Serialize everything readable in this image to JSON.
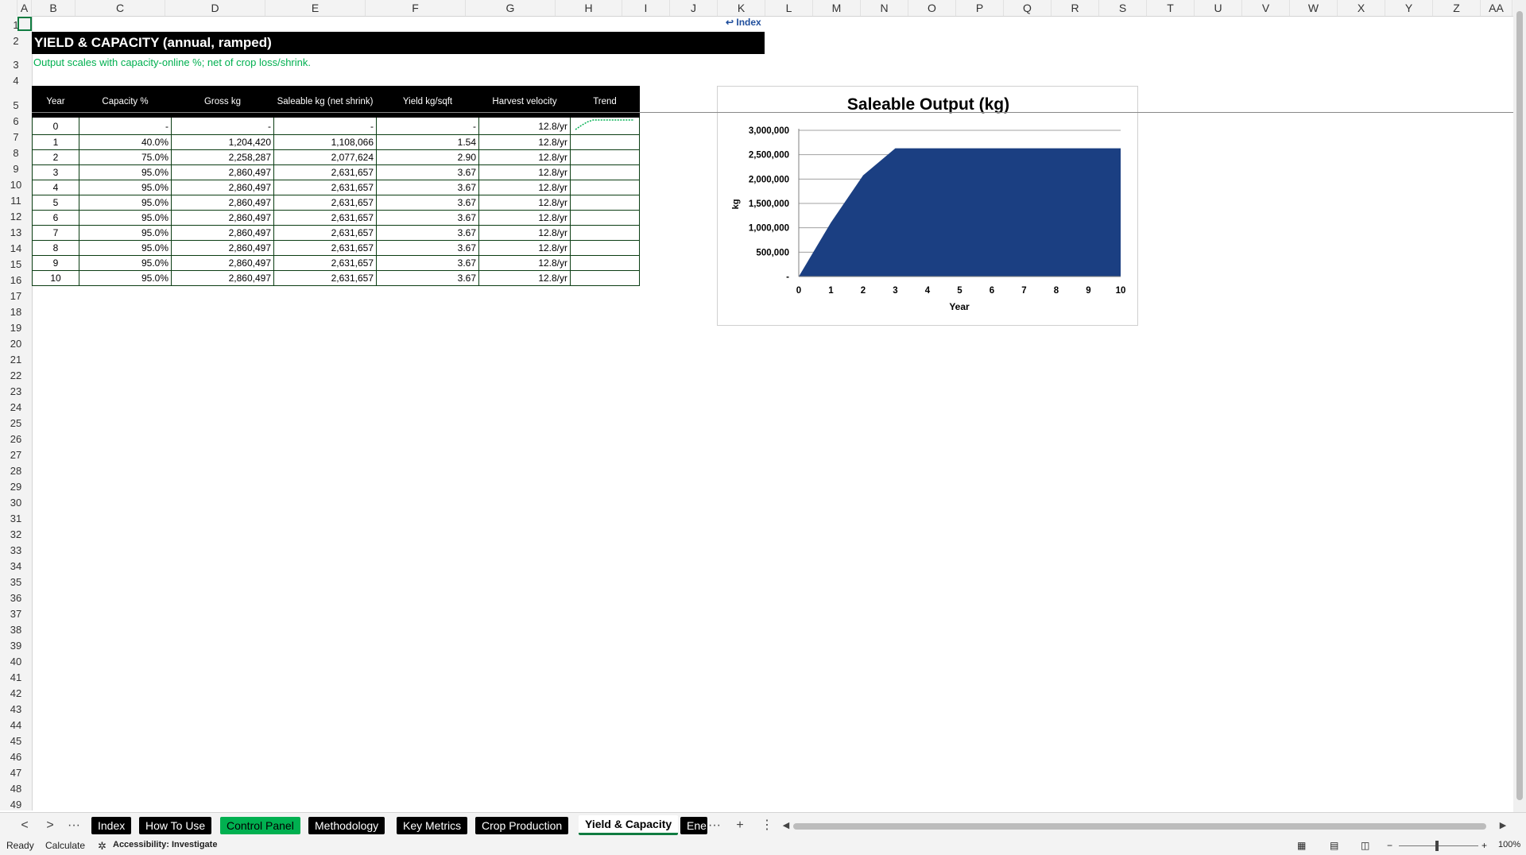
{
  "columns": [
    "A",
    "B",
    "C",
    "D",
    "E",
    "F",
    "G",
    "H",
    "I",
    "J",
    "K",
    "L",
    "M",
    "N",
    "O",
    "P",
    "Q",
    "R",
    "S",
    "T",
    "U",
    "V",
    "W",
    "X",
    "Y",
    "Z",
    "AA"
  ],
  "rows": [
    "1",
    "2",
    "3",
    "4",
    "5",
    "6",
    "7",
    "8",
    "9",
    "10",
    "11",
    "12",
    "13",
    "14",
    "15",
    "16",
    "17",
    "18",
    "19",
    "20",
    "21",
    "22",
    "23",
    "24",
    "25",
    "26",
    "27",
    "28",
    "29",
    "30",
    "31",
    "32",
    "33",
    "34",
    "35",
    "36",
    "37",
    "38",
    "39",
    "40",
    "41",
    "42",
    "43",
    "44",
    "45",
    "46",
    "47",
    "48",
    "49"
  ],
  "sheet": {
    "index_link": "↩ Index",
    "title": "YIELD & CAPACITY (annual, ramped)",
    "subtitle": "Output scales with capacity-online %; net of crop loss/shrink."
  },
  "table": {
    "headers": [
      "Year",
      "Capacity %",
      "Gross kg",
      "Saleable kg (net shrink)",
      "Yield kg/sqft",
      "Harvest velocity",
      "Trend"
    ],
    "rows": [
      [
        "0",
        "-",
        "-",
        "-",
        "-",
        "12.8/yr"
      ],
      [
        "1",
        "40.0%",
        "1,204,420",
        "1,108,066",
        "1.54",
        "12.8/yr"
      ],
      [
        "2",
        "75.0%",
        "2,258,287",
        "2,077,624",
        "2.90",
        "12.8/yr"
      ],
      [
        "3",
        "95.0%",
        "2,860,497",
        "2,631,657",
        "3.67",
        "12.8/yr"
      ],
      [
        "4",
        "95.0%",
        "2,860,497",
        "2,631,657",
        "3.67",
        "12.8/yr"
      ],
      [
        "5",
        "95.0%",
        "2,860,497",
        "2,631,657",
        "3.67",
        "12.8/yr"
      ],
      [
        "6",
        "95.0%",
        "2,860,497",
        "2,631,657",
        "3.67",
        "12.8/yr"
      ],
      [
        "7",
        "95.0%",
        "2,860,497",
        "2,631,657",
        "3.67",
        "12.8/yr"
      ],
      [
        "8",
        "95.0%",
        "2,860,497",
        "2,631,657",
        "3.67",
        "12.8/yr"
      ],
      [
        "9",
        "95.0%",
        "2,860,497",
        "2,631,657",
        "3.67",
        "12.8/yr"
      ],
      [
        "10",
        "95.0%",
        "2,860,497",
        "2,631,657",
        "3.67",
        "12.8/yr"
      ]
    ]
  },
  "chart_data": {
    "type": "area",
    "title": "Saleable Output (kg)",
    "xlabel": "Year",
    "ylabel": "kg",
    "x": [
      0,
      1,
      2,
      3,
      4,
      5,
      6,
      7,
      8,
      9,
      10
    ],
    "values": [
      0,
      1108066,
      2077624,
      2631657,
      2631657,
      2631657,
      2631657,
      2631657,
      2631657,
      2631657,
      2631657
    ],
    "ylim": [
      0,
      3000000
    ],
    "yticks": [
      "-",
      "500,000",
      "1,000,000",
      "1,500,000",
      "2,000,000",
      "2,500,000",
      "3,000,000"
    ],
    "grid": true,
    "color": "#1b3f82"
  },
  "sparkline": {
    "values": [
      0,
      1108066,
      2077624,
      2631657,
      2631657,
      2631657,
      2631657,
      2631657,
      2631657,
      2631657,
      2631657
    ],
    "color": "#00b050"
  },
  "tabs": [
    "Index",
    "How To Use",
    "Control Panel",
    "Methodology",
    "Key Metrics",
    "Crop Production",
    "Yield & Capacity",
    "Ene"
  ],
  "tab_nav": {
    "prev": "<",
    "next": ">",
    "more_left": "···",
    "more_right": "···",
    "add": "+",
    "options": "⋮"
  },
  "status": {
    "ready": "Ready",
    "calculate": "Calculate",
    "accessibility": "Accessibility: Investigate",
    "zoom": "100%"
  }
}
